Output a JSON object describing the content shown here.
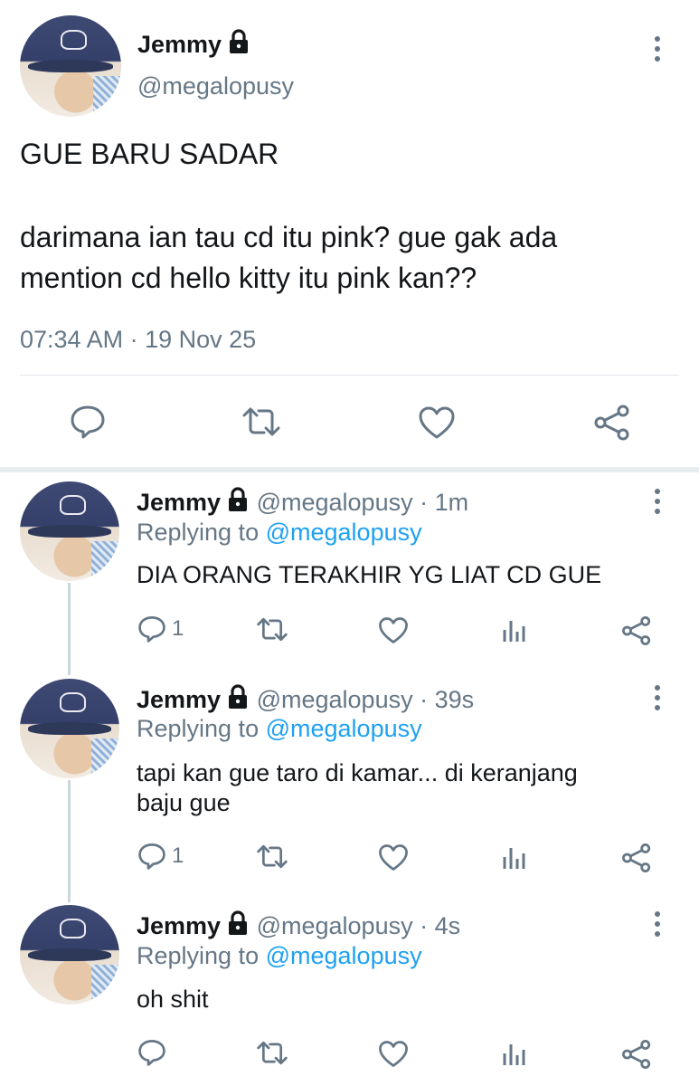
{
  "main_tweet": {
    "name": "Jemmy",
    "handle": "@megalopusy",
    "text_line1": "GUE BARU SADAR",
    "text_line2": "darimana ian tau cd itu pink? gue gak ada",
    "text_line3": "mention cd hello kitty itu pink kan??",
    "time": "07:34 AM",
    "separator": "·",
    "date": "19 Nov 25",
    "icons": [
      "comment-icon",
      "retweet-icon",
      "like-icon",
      "share-icon"
    ]
  },
  "replies": [
    {
      "name": "Jemmy",
      "handle": "@megalopusy",
      "dot": "·",
      "age": "1m",
      "replying_prefix": "Replying to",
      "replying_handle": "@megalopusy",
      "text_lines": [
        "DIA ORANG TERAKHIR YG LIAT CD GUE"
      ],
      "reply_count": "1"
    },
    {
      "name": "Jemmy",
      "handle": "@megalopusy",
      "dot": "·",
      "age": "39s",
      "replying_prefix": "Replying to",
      "replying_handle": "@megalopusy",
      "text_lines": [
        "tapi kan gue taro di kamar... di keranjang",
        "baju gue"
      ],
      "reply_count": "1"
    },
    {
      "name": "Jemmy",
      "handle": "@megalopusy",
      "dot": "·",
      "age": "4s",
      "replying_prefix": "Replying to",
      "replying_handle": "@megalopusy",
      "text_lines": [
        "oh shit"
      ],
      "reply_count": ""
    }
  ],
  "colors": {
    "text": "#14171a",
    "secondary": "#657786",
    "link": "#1da1f2",
    "divider": "#e1e8ed"
  }
}
